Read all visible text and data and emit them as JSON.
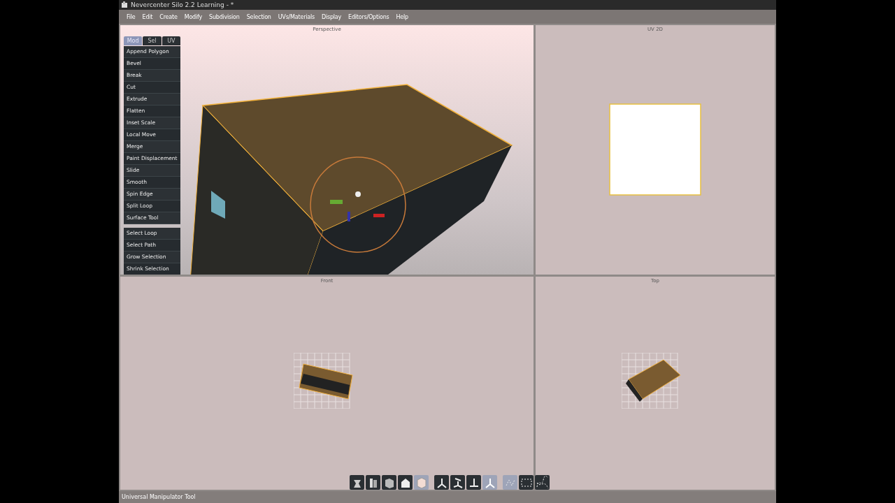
{
  "window": {
    "title": "Nevercenter Silo 2.2 Learning - *"
  },
  "menu": [
    "File",
    "Edit",
    "Create",
    "Modify",
    "Subdivision",
    "Selection",
    "UVs/Materials",
    "Display",
    "Editors/Options",
    "Help"
  ],
  "viewports": [
    {
      "title": "Perspective",
      "kind": "perspective"
    },
    {
      "title": "UV 2D",
      "kind": "uv"
    },
    {
      "title": "Front",
      "kind": "front"
    },
    {
      "title": "Top",
      "kind": "top"
    }
  ],
  "tool_panel": {
    "tabs": [
      {
        "label": "Mod",
        "selected": true
      },
      {
        "label": "Sel",
        "selected": false
      },
      {
        "label": "UV",
        "selected": false
      }
    ],
    "tools": [
      "Append Polygon",
      "Bevel",
      "Break",
      "Cut",
      "Extrude",
      "Flatten",
      "Inset Scale",
      "Local Move",
      "Merge",
      "Paint Displacement",
      "Slide",
      "Smooth",
      "Spin Edge",
      "Split Loop",
      "Surface Tool"
    ],
    "selection_tools": [
      "Select Loop",
      "Select Path",
      "Grow Selection",
      "Shrink Selection"
    ]
  },
  "toolbar": [
    [
      {
        "selected": false
      },
      {
        "selected": false
      },
      {
        "selected": false
      },
      {
        "selected": false
      },
      {
        "selected": true
      }
    ],
    [
      {
        "selected": false
      },
      {
        "selected": false
      },
      {
        "selected": false
      },
      {
        "selected": true
      }
    ],
    [
      {
        "selected": true
      },
      {
        "selected": false
      },
      {
        "selected": false
      }
    ]
  ],
  "status_bar": "Universal Manipulator Tool"
}
